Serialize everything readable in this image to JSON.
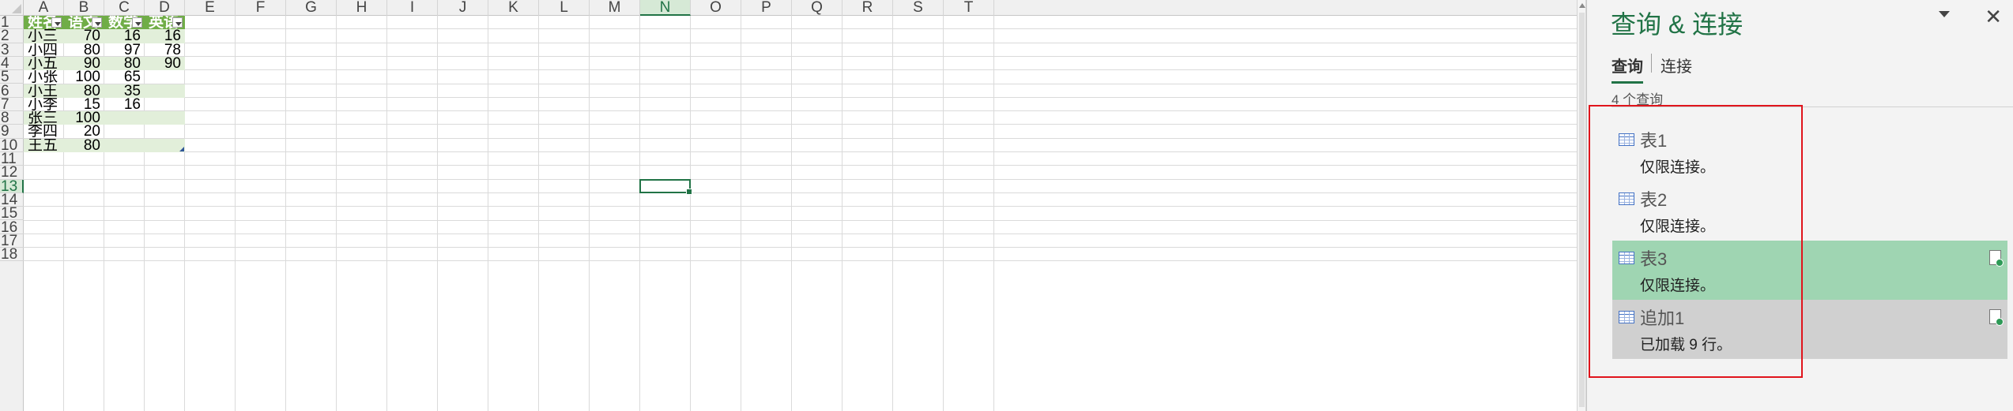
{
  "sheet": {
    "columns": [
      "A",
      "B",
      "C",
      "D",
      "E",
      "F",
      "G",
      "H",
      "I",
      "J",
      "K",
      "L",
      "M",
      "N",
      "O",
      "P",
      "Q",
      "R",
      "S",
      "T"
    ],
    "active_column": "N",
    "rows": [
      "1",
      "2",
      "3",
      "4",
      "5",
      "6",
      "7",
      "8",
      "9",
      "10",
      "11",
      "12",
      "13",
      "14",
      "15",
      "16",
      "17",
      "18"
    ],
    "active_row": "13",
    "table_headers": [
      "姓名",
      "语文",
      "数学",
      "英语"
    ],
    "table_rows": [
      [
        "小三",
        "70",
        "16",
        "16"
      ],
      [
        "小四",
        "80",
        "97",
        "78"
      ],
      [
        "小五",
        "90",
        "80",
        "90"
      ],
      [
        "小张",
        "100",
        "65",
        ""
      ],
      [
        "小王",
        "80",
        "35",
        ""
      ],
      [
        "小李",
        "15",
        "16",
        ""
      ],
      [
        "张三",
        "100",
        "",
        ""
      ],
      [
        "李四",
        "20",
        "",
        ""
      ],
      [
        "王五",
        "80",
        "",
        ""
      ]
    ],
    "active_cell": "N13"
  },
  "pane": {
    "title": "查询 & 连接",
    "close_symbol": "✕",
    "tabs": {
      "queries": "查询",
      "connections": "连接"
    },
    "query_count": "4 个查询",
    "queries": [
      {
        "name": "表1",
        "status": "仅限连接。"
      },
      {
        "name": "表2",
        "status": "仅限连接。"
      },
      {
        "name": "表3",
        "status": "仅限连接。"
      },
      {
        "name": "追加1",
        "status": "已加载 9 行。"
      }
    ]
  },
  "colors": {
    "excel_green": "#217346",
    "table_header": "#70ad47",
    "table_band": "#e2efda",
    "selected_query": "#9fd5b2",
    "highlight_box": "#e0141c"
  }
}
